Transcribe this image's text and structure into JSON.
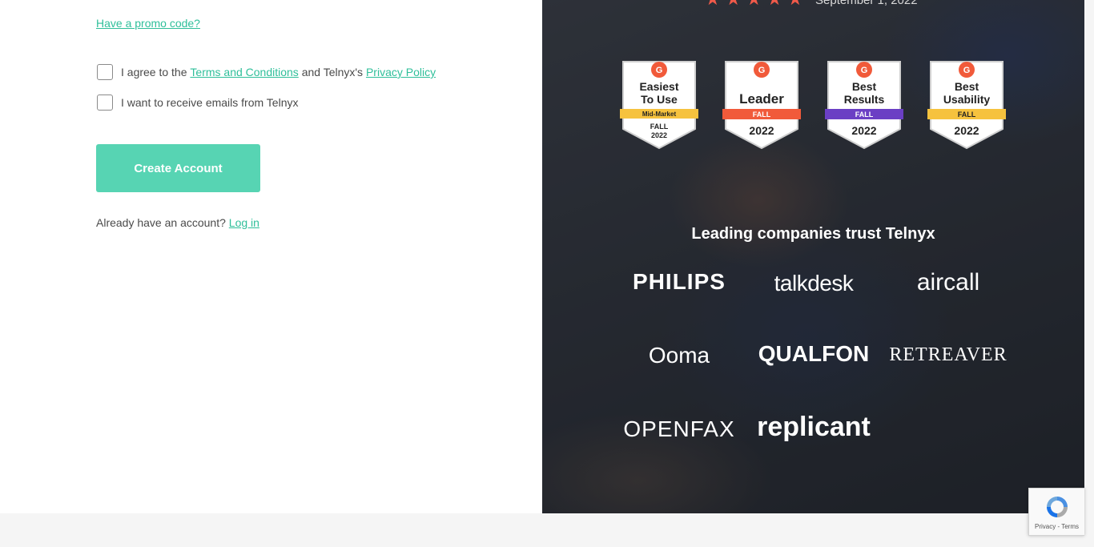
{
  "form": {
    "promo_link": "Have a promo code?",
    "agree_prefix": "I agree to the",
    "terms_link": "Terms and Conditions",
    "agree_middle": "and Telnyx's",
    "privacy_link": "Privacy Policy",
    "emails_label": "I want to receive emails from Telnyx",
    "create_button": "Create Account",
    "login_prefix": "Already have an account?",
    "login_link": "Log in"
  },
  "review": {
    "stars": 5,
    "date": "September 1, 2022"
  },
  "badges": [
    {
      "line1": "Easiest",
      "line2": "To Use",
      "ribbon": "Mid-Market",
      "season": "FALL",
      "year": "2022",
      "ribbon_color": "#f6c23e"
    },
    {
      "line1": "Leader",
      "line2": "",
      "ribbon": "FALL",
      "season": "",
      "year": "2022",
      "ribbon_color": "#f15a3a"
    },
    {
      "line1": "Best",
      "line2": "Results",
      "ribbon": "FALL",
      "season": "",
      "year": "2022",
      "ribbon_color": "#6b3fc4"
    },
    {
      "line1": "Best",
      "line2": "Usability",
      "ribbon": "FALL",
      "season": "",
      "year": "2022",
      "ribbon_color": "#f6c23e"
    }
  ],
  "trust_heading": "Leading companies trust Telnyx",
  "logos": [
    "PHILIPS",
    "talkdesk",
    "aircall",
    "Ooma",
    "QUALFON",
    "RETREAVER",
    "OPENFAX",
    "replicant"
  ],
  "recaptcha": {
    "text": "Privacy - Terms"
  },
  "colors": {
    "accent": "#2fbf9a",
    "button": "#57d4b3",
    "star": "#f05a4a"
  }
}
